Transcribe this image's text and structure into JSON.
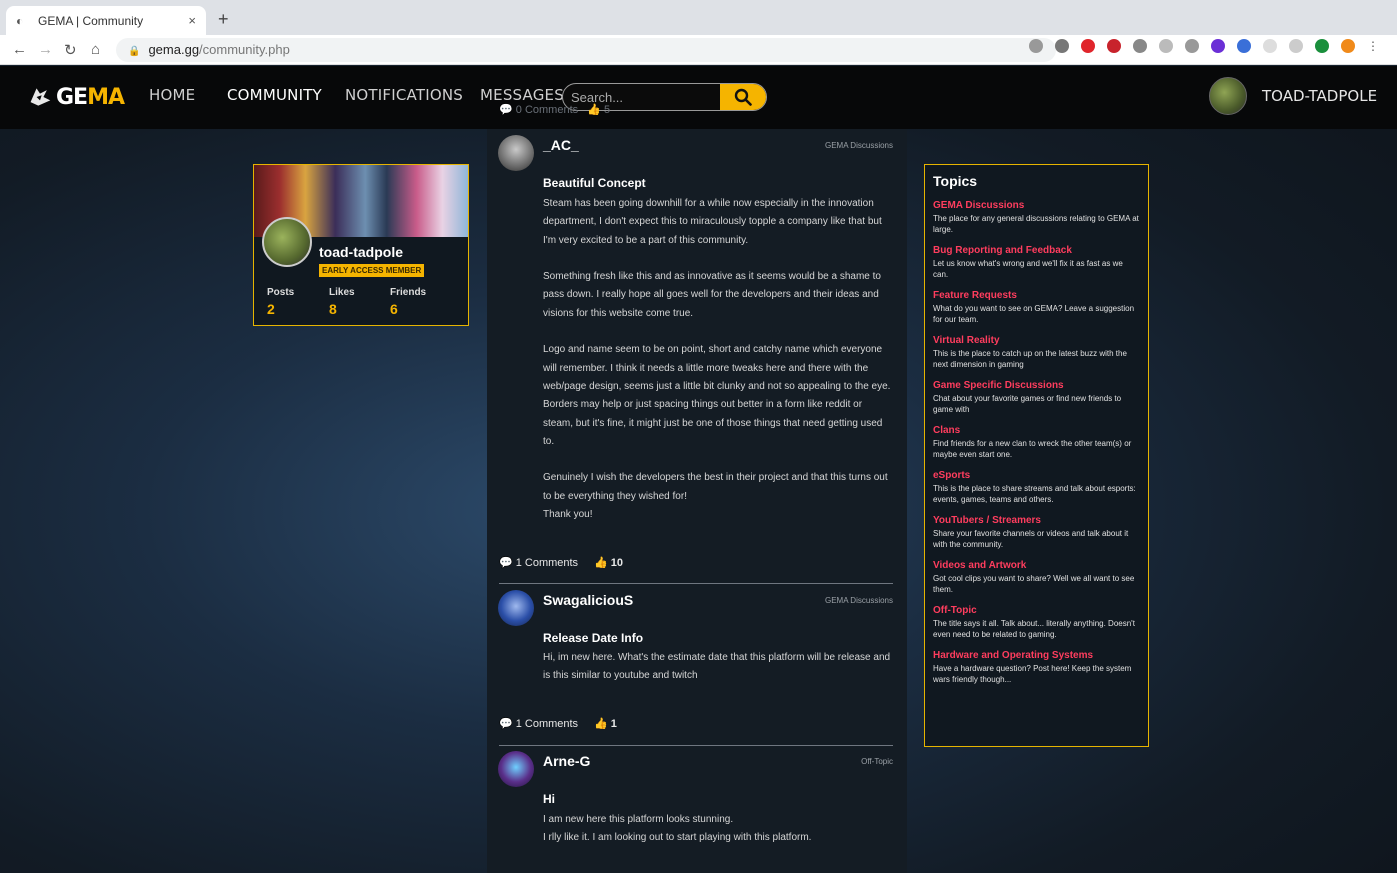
{
  "browser": {
    "tab_title": "GEMA | Community",
    "tab_close": "×",
    "new_tab": "+",
    "url_domain": "gema.gg",
    "url_path": "/community.php"
  },
  "nav": {
    "logo_prefix": "GE",
    "logo_accent": "MA",
    "items": [
      "HOME",
      "COMMUNITY",
      "NOTIFICATIONS",
      "MESSAGES"
    ],
    "active": "COMMUNITY",
    "search_placeholder": "Search...",
    "user_name": "TOAD-TADPOLE"
  },
  "profile": {
    "username": "toad-tadpole",
    "badge": "EARLY ACCESS MEMBER",
    "stats": [
      {
        "label": "Posts",
        "value": "2"
      },
      {
        "label": "Likes",
        "value": "8"
      },
      {
        "label": "Friends",
        "value": "6"
      }
    ]
  },
  "feed": {
    "ghost_comments": "0 Comments",
    "ghost_likes": "5",
    "posts": [
      {
        "author": "_AC_",
        "topic": "GEMA Discussions",
        "title": "Beautiful Concept",
        "body": [
          "Steam has been going downhill for a while now especially in the innovation department, I don't expect this to miraculously topple a company like that but I'm very excited to be a part of this community.",
          "Something fresh like this and as innovative as it seems would be a shame to pass down. I really hope all goes well for the developers and their ideas and visions for this website come true.",
          "Logo and name seem to be on point, short and catchy name which everyone will remember. I think it needs a little more tweaks here and there with the web/page design, seems just a little bit clunky and not so appealing to the eye. Borders may help or just spacing things out better in a form like reddit or steam, but it's fine, it might just be one of those things that need getting used to.",
          "Genuinely I wish the developers the best in their project and that this turns out to be everything they wished for!\nThank you!"
        ],
        "comments": "1 Comments",
        "likes": "10",
        "avatar_color": "#8a8a8a"
      },
      {
        "author": "SwagaliciouS",
        "topic": "GEMA Discussions",
        "title": "Release Date Info",
        "body": [
          "Hi, im new here. What's the estimate date that this platform will be release and is this similar to youtube and twitch"
        ],
        "comments": "1 Comments",
        "likes": "1",
        "avatar_color": "#2b4fa8"
      },
      {
        "author": "Arne-G",
        "topic": "Off-Topic",
        "title": "Hi",
        "body": [
          "I am new here this platform looks stunning.\nI rlly like it. I am looking out to start playing with this platform."
        ],
        "avatar_color": "#5a2f8a"
      }
    ]
  },
  "topics": {
    "heading": "Topics",
    "items": [
      {
        "name": "GEMA Discussions",
        "desc": "The place for any general discussions relating to GEMA at large."
      },
      {
        "name": "Bug Reporting and Feedback",
        "desc": "Let us know what's wrong and we'll fix it as fast as we can."
      },
      {
        "name": "Feature Requests",
        "desc": "What do you want to see on GEMA? Leave a suggestion for our team."
      },
      {
        "name": "Virtual Reality",
        "desc": "This is the place to catch up on the latest buzz with the next dimension in gaming"
      },
      {
        "name": "Game Specific Discussions",
        "desc": "Chat about your favorite games or find new friends to game with"
      },
      {
        "name": "Clans",
        "desc": "Find friends for a new clan to wreck the other team(s) or maybe even start one."
      },
      {
        "name": "eSports",
        "desc": "This is the place to share streams and talk about esports: events, games, teams and others."
      },
      {
        "name": "YouTubers / Streamers",
        "desc": "Share your favorite channels or videos and talk about it with the community."
      },
      {
        "name": "Videos and Artwork",
        "desc": "Got cool clips you want to share? Well we all want to see them."
      },
      {
        "name": "Off-Topic",
        "desc": "The title says it all. Talk about... literally anything. Doesn't even need to be related to gaming."
      },
      {
        "name": "Hardware and Operating Systems",
        "desc": "Have a hardware question? Post here! Keep the system wars friendly though..."
      }
    ]
  },
  "colors": {
    "accent": "#f5b400",
    "topic_link": "#ff3d5e",
    "nav_bg": "#070809"
  }
}
